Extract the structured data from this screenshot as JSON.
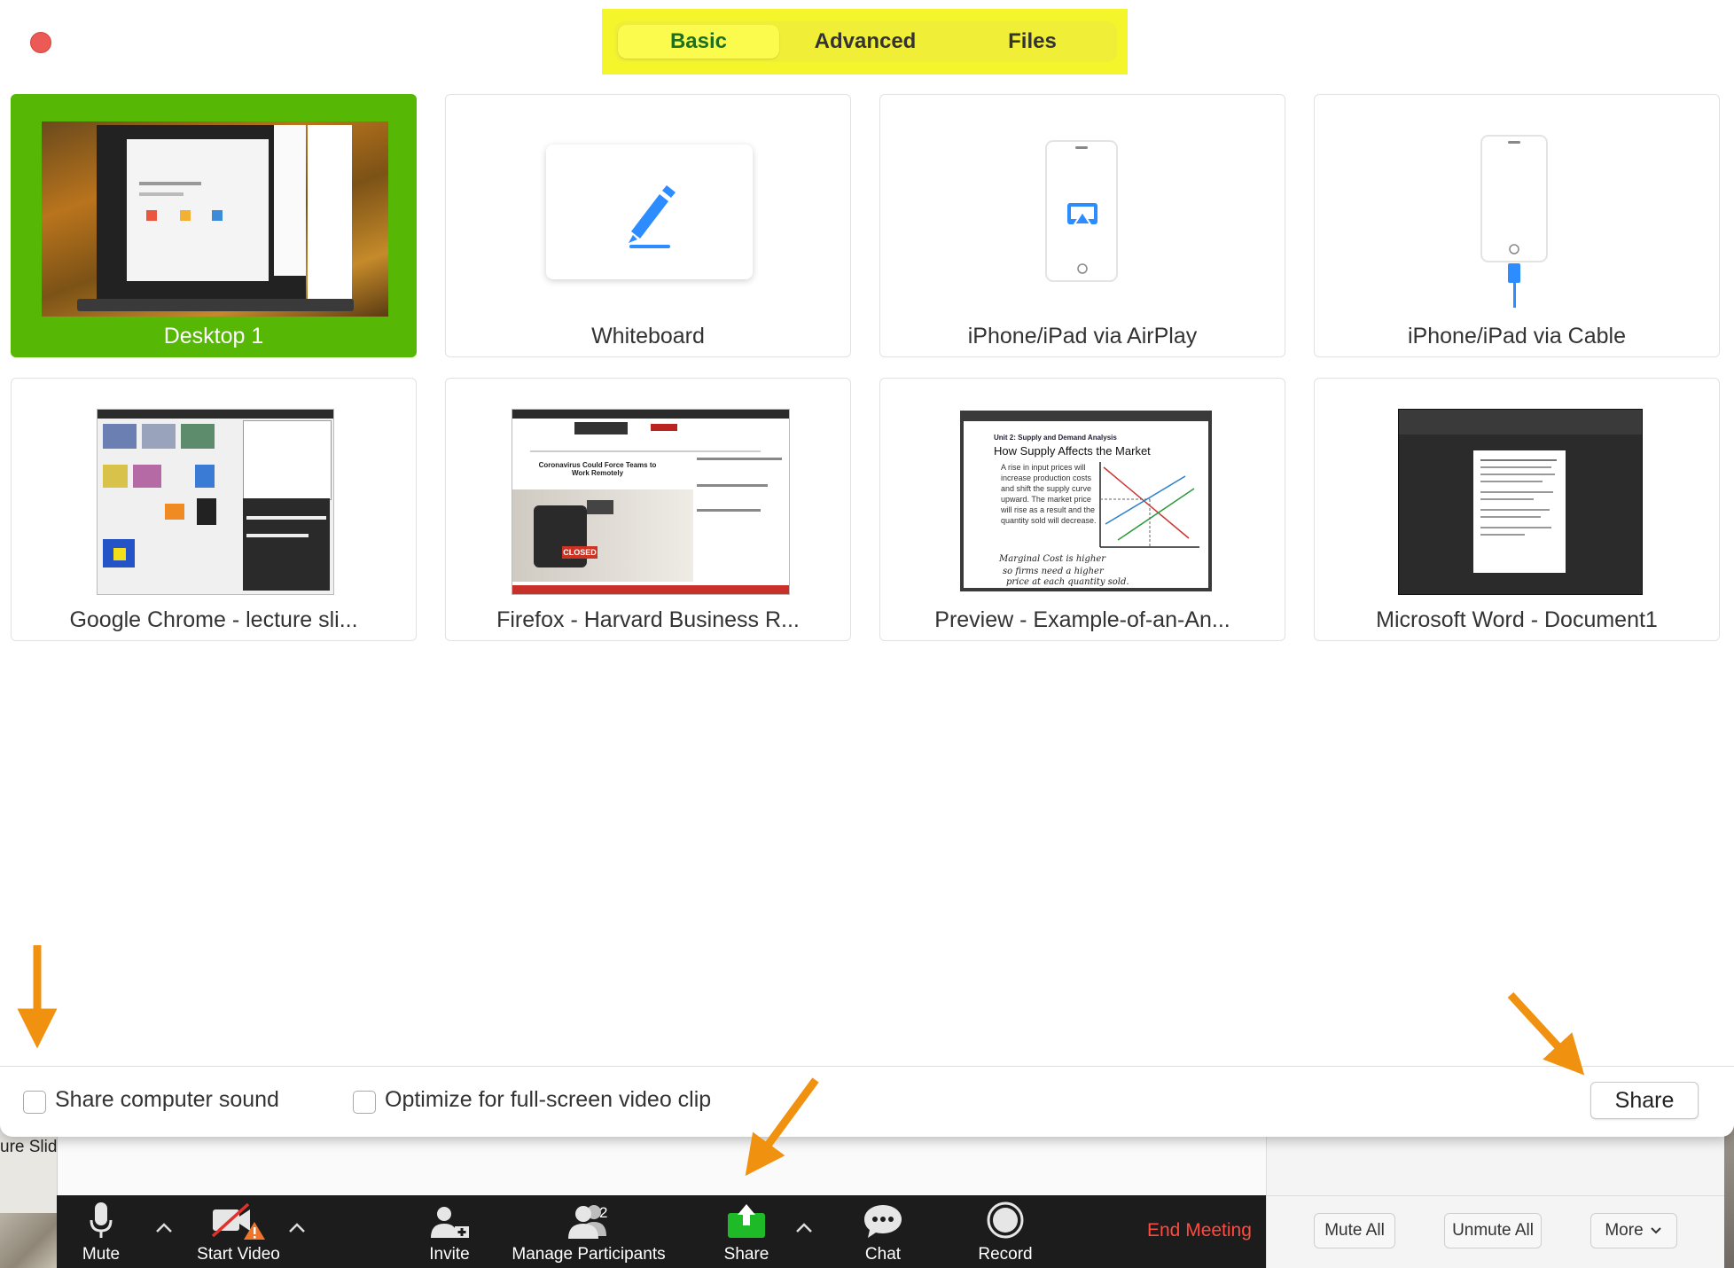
{
  "tabs": [
    {
      "label": "Basic",
      "active": true
    },
    {
      "label": "Advanced",
      "active": false
    },
    {
      "label": "Files",
      "active": false
    }
  ],
  "tiles": [
    {
      "label": "Desktop 1",
      "selected": true
    },
    {
      "label": "Whiteboard"
    },
    {
      "label": "iPhone/iPad via AirPlay"
    },
    {
      "label": "iPhone/iPad via Cable"
    },
    {
      "label": "Google Chrome - lecture sli..."
    },
    {
      "label": "Firefox - Harvard Business R..."
    },
    {
      "label": "Preview - Example-of-an-An..."
    },
    {
      "label": "Microsoft Word - Document1"
    }
  ],
  "preview_doc": {
    "unit": "Unit 2: Supply and Demand Analysis",
    "title": "How Supply Affects the Market",
    "bullet": "A rise in input prices will increase production costs and shift the supply curve upward. The market price will rise as a result and the quantity sold will decrease.",
    "note1": "Marginal Cost is higher",
    "note2": "so firms need a higher",
    "note3": "price at each quantity sold."
  },
  "firefox_doc": {
    "headline": "Coronavirus Could Force Teams to Work Remotely",
    "sign": "CLOSED"
  },
  "options": {
    "share_sound": "Share computer sound",
    "optimize_video": "Optimize for full-screen video clip",
    "share_sound_checked": false,
    "optimize_video_checked": false
  },
  "share_button": "Share",
  "background_text": "ure Slid",
  "toolbar": {
    "mute": "Mute",
    "start_video": "Start Video",
    "invite": "Invite",
    "manage_participants": "Manage Participants",
    "participants_count": "2",
    "share": "Share",
    "chat": "Chat",
    "record": "Record",
    "end_meeting": "End Meeting"
  },
  "participants_panel": {
    "mute_all": "Mute All",
    "unmute_all": "Unmute All",
    "more": "More"
  },
  "colors": {
    "accent_green": "#56b804",
    "share_icon_green": "#1fba27",
    "tab_highlight": "#f4f52b",
    "end_meeting_red": "#ff4a3f",
    "annotation_arrow": "#f0920f",
    "whiteboard_pen": "#2d8cff"
  }
}
